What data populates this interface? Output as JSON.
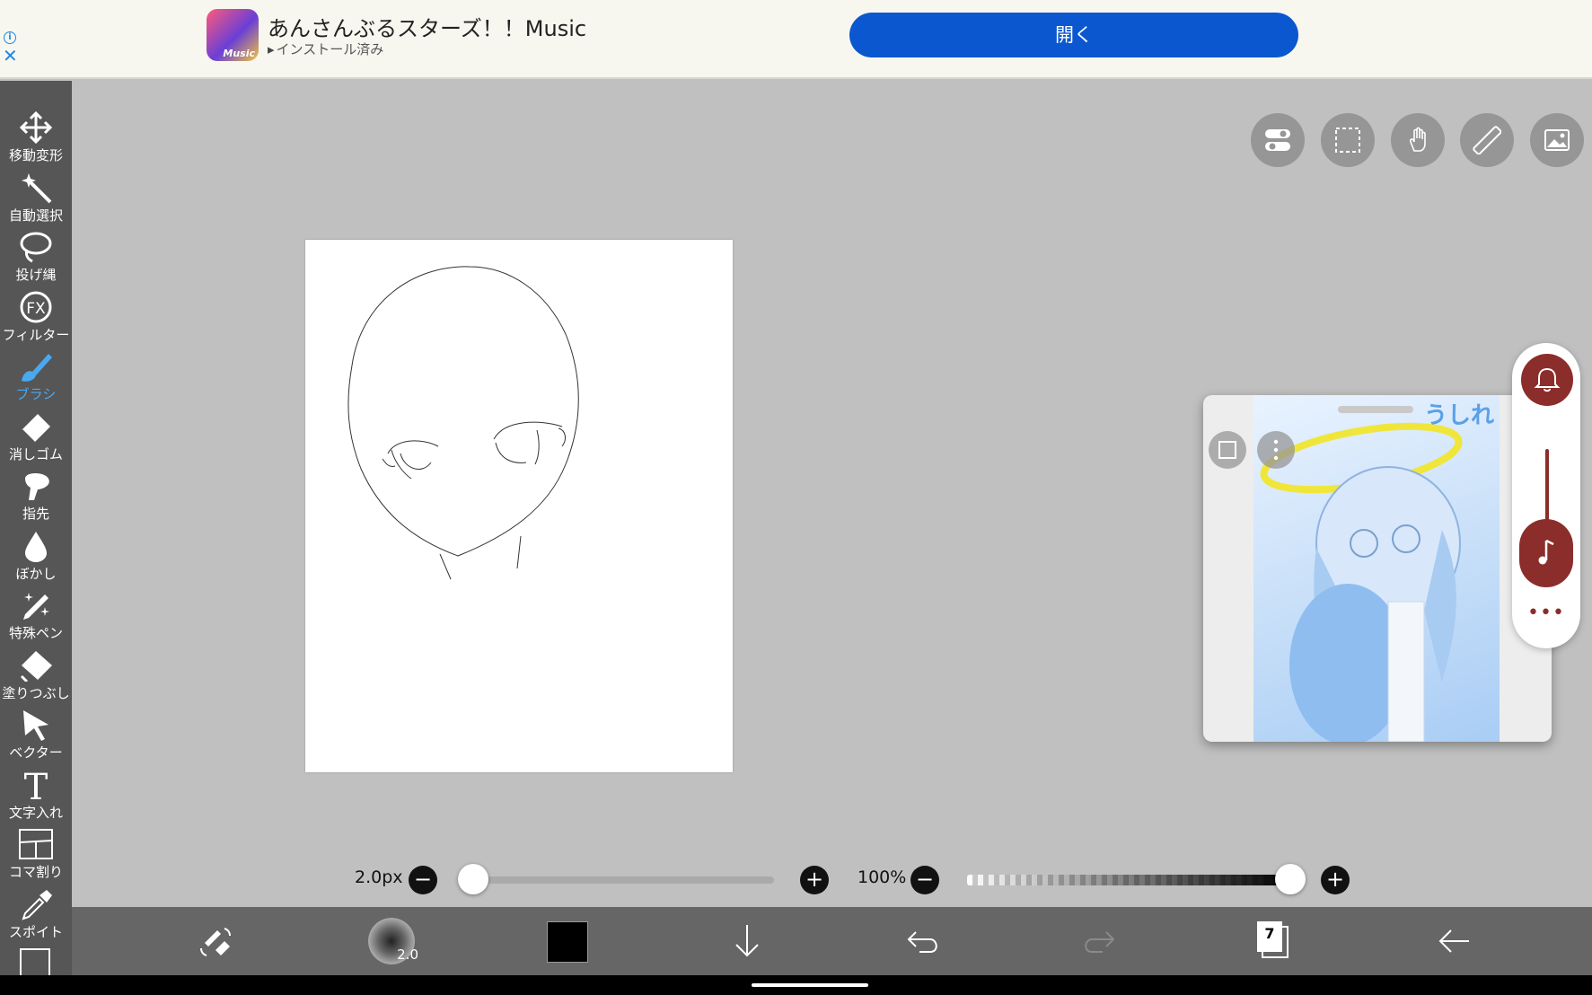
{
  "ad": {
    "app_title": "あんさんぶるスターズ！！Music",
    "icon_text": "Music",
    "installed_label": "インストール済み",
    "open_button_label": "開く",
    "info_glyph": "i",
    "close_glyph": "✕"
  },
  "tools": [
    {
      "id": "move-transform",
      "label": "移動変形",
      "icon": "move-icon"
    },
    {
      "id": "auto-select",
      "label": "自動選択",
      "icon": "magic-wand-icon"
    },
    {
      "id": "lasso",
      "label": "投げ縄",
      "icon": "lasso-icon"
    },
    {
      "id": "filter",
      "label": "フィルター",
      "icon": "fx-icon",
      "glyph": "FX"
    },
    {
      "id": "brush",
      "label": "ブラシ",
      "icon": "brush-icon",
      "active": true
    },
    {
      "id": "eraser",
      "label": "消しゴム",
      "icon": "eraser-icon"
    },
    {
      "id": "finger",
      "label": "指先",
      "icon": "smudge-icon"
    },
    {
      "id": "blur",
      "label": "ぼかし",
      "icon": "drop-icon"
    },
    {
      "id": "special-pen",
      "label": "特殊ペン",
      "icon": "sparkle-pen-icon"
    },
    {
      "id": "fill",
      "label": "塗りつぶし",
      "icon": "bucket-icon"
    },
    {
      "id": "vector",
      "label": "ベクター",
      "icon": "cursor-arrow-icon"
    },
    {
      "id": "text",
      "label": "文字入れ",
      "icon": "text-icon",
      "glyph": "T"
    },
    {
      "id": "frame-divider",
      "label": "コマ割り",
      "icon": "panels-icon"
    },
    {
      "id": "eyedropper",
      "label": "スポイト",
      "icon": "eyedropper-icon"
    }
  ],
  "top_buttons": [
    "toggle-icon",
    "selection-icon",
    "hand-icon",
    "ruler-icon",
    "image-icon"
  ],
  "pip": {
    "watermark": "うしれ"
  },
  "side_panel": {
    "more_glyph": "•••"
  },
  "brush": {
    "size_label": "2.0px",
    "size_fraction": 0.0,
    "preview_size": "2.0",
    "minus_glyph": "−",
    "plus_glyph": "+"
  },
  "opacity": {
    "label": "100%",
    "value_fraction": 1.0,
    "minus_glyph": "−",
    "plus_glyph": "+"
  },
  "bottom": {
    "layer_count": "7",
    "current_color": "#000000"
  },
  "colors": {
    "accent_blue": "#4aa8f0",
    "ad_button": "#0b57d0",
    "panel_red": "#8b2d2a"
  }
}
